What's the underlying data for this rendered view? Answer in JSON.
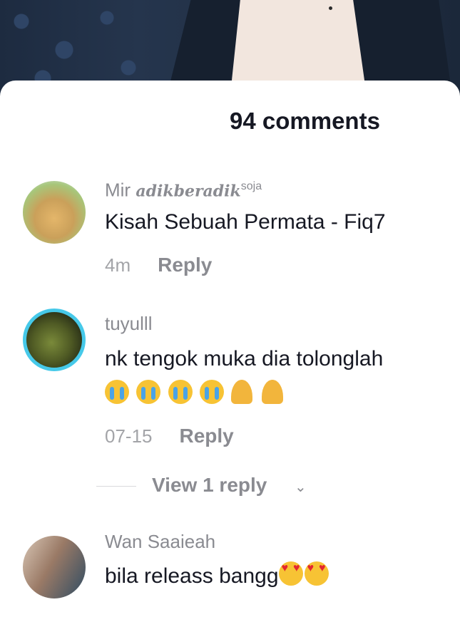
{
  "header": {
    "comment_count_label": "94 comments"
  },
  "comments": [
    {
      "username_plain": "Mir ",
      "username_fancy": "adikberadik",
      "username_sup": "soja",
      "text": "Kisah Sebuah Permata - Fiq7",
      "time": "4m",
      "reply_label": "Reply"
    },
    {
      "username_plain": "tuyulll",
      "text": "nk tengok muka dia tolonglah",
      "emoji_line": [
        "loudly-crying-face",
        "loudly-crying-face",
        "loudly-crying-face",
        "loudly-crying-face",
        "folded-hands",
        "folded-hands"
      ],
      "time": "07-15",
      "reply_label": "Reply",
      "view_replies_label": "View 1 reply"
    },
    {
      "username_plain": "Wan Saaieah",
      "text": "bila releass bangg",
      "emoji_trailing": [
        "smiling-face-with-heart-eyes",
        "smiling-face-with-heart-eyes"
      ]
    }
  ],
  "colors": {
    "text_primary": "#161823",
    "text_secondary": "#8a8b91",
    "avatar_ring": "#46c9e9"
  }
}
